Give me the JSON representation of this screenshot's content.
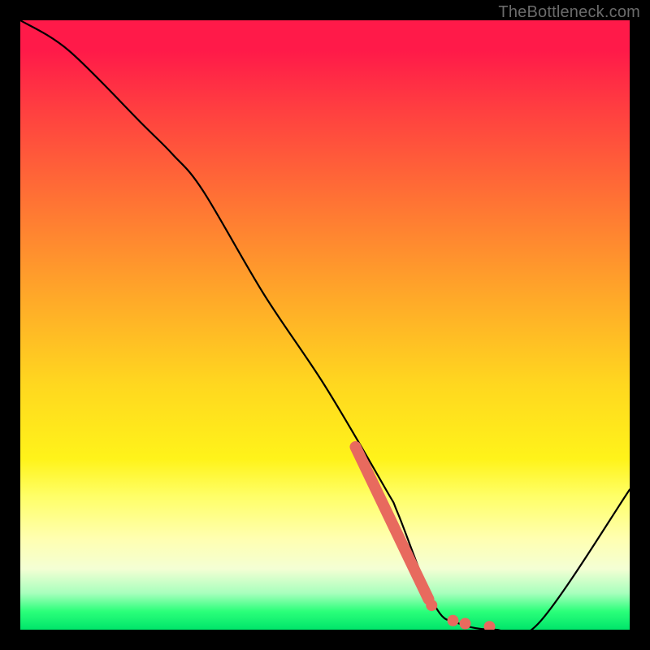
{
  "watermark": "TheBottleneck.com",
  "chart_data": {
    "type": "line",
    "title": "",
    "xlabel": "",
    "ylabel": "",
    "xlim": [
      0,
      100
    ],
    "ylim": [
      0,
      100
    ],
    "series": [
      {
        "name": "curve",
        "x": [
          0,
          8,
          20,
          25,
          30,
          40,
          50,
          60,
          62,
          68,
          72,
          78,
          85,
          100
        ],
        "y": [
          100,
          95,
          83,
          78,
          72,
          55,
          40,
          23,
          19,
          4,
          1,
          0,
          1,
          23
        ]
      }
    ],
    "highlight_segment": {
      "comment": "thick salmon segment + dots near trough",
      "line": {
        "x": [
          55,
          67
        ],
        "y": [
          30,
          5
        ]
      },
      "dots": [
        {
          "x": 67.5,
          "y": 4
        },
        {
          "x": 71,
          "y": 1.5
        },
        {
          "x": 73,
          "y": 1
        },
        {
          "x": 77,
          "y": 0.5
        }
      ],
      "color": "#e86a5e"
    }
  }
}
